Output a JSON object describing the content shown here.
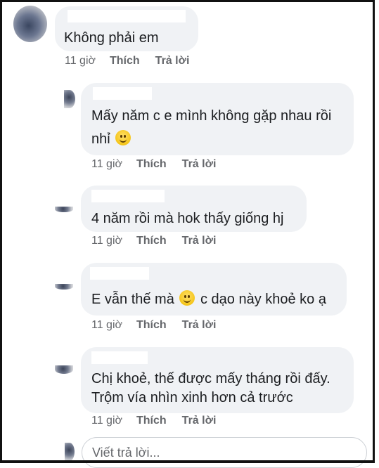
{
  "comments": [
    {
      "text": "Không phải em",
      "time": "11 giờ",
      "like": "Thích",
      "reply": "Trả lời"
    },
    {
      "text_line1": "Mấy năm c e mình không gặp nhau rồi",
      "text_line2": "nhỉ",
      "emoji": "smile-emoji",
      "time": "11 giờ",
      "like": "Thích",
      "reply": "Trả lời"
    },
    {
      "text": "4 năm rồi mà hok thấy giống hj",
      "time": "11 giờ",
      "like": "Thích",
      "reply": "Trả lời"
    },
    {
      "text_before": "E vẫn thế mà",
      "emoji": "smile-emoji",
      "text_after": "c dạo này khoẻ ko ạ",
      "time": "11 giờ",
      "like": "Thích",
      "reply": "Trả lời"
    },
    {
      "text_line1": "Chị khoẻ, thế được mấy tháng rồi đấy.",
      "text_line2": "Trộm vía nhìn xinh hơn cả trước",
      "time": "11 giờ",
      "like": "Thích",
      "reply": "Trả lời"
    }
  ],
  "reply_input": {
    "placeholder": "Viết trả lời..."
  },
  "colors": {
    "bubble": "#f0f2f5",
    "meta": "#65676b",
    "text": "#1c1e21"
  }
}
